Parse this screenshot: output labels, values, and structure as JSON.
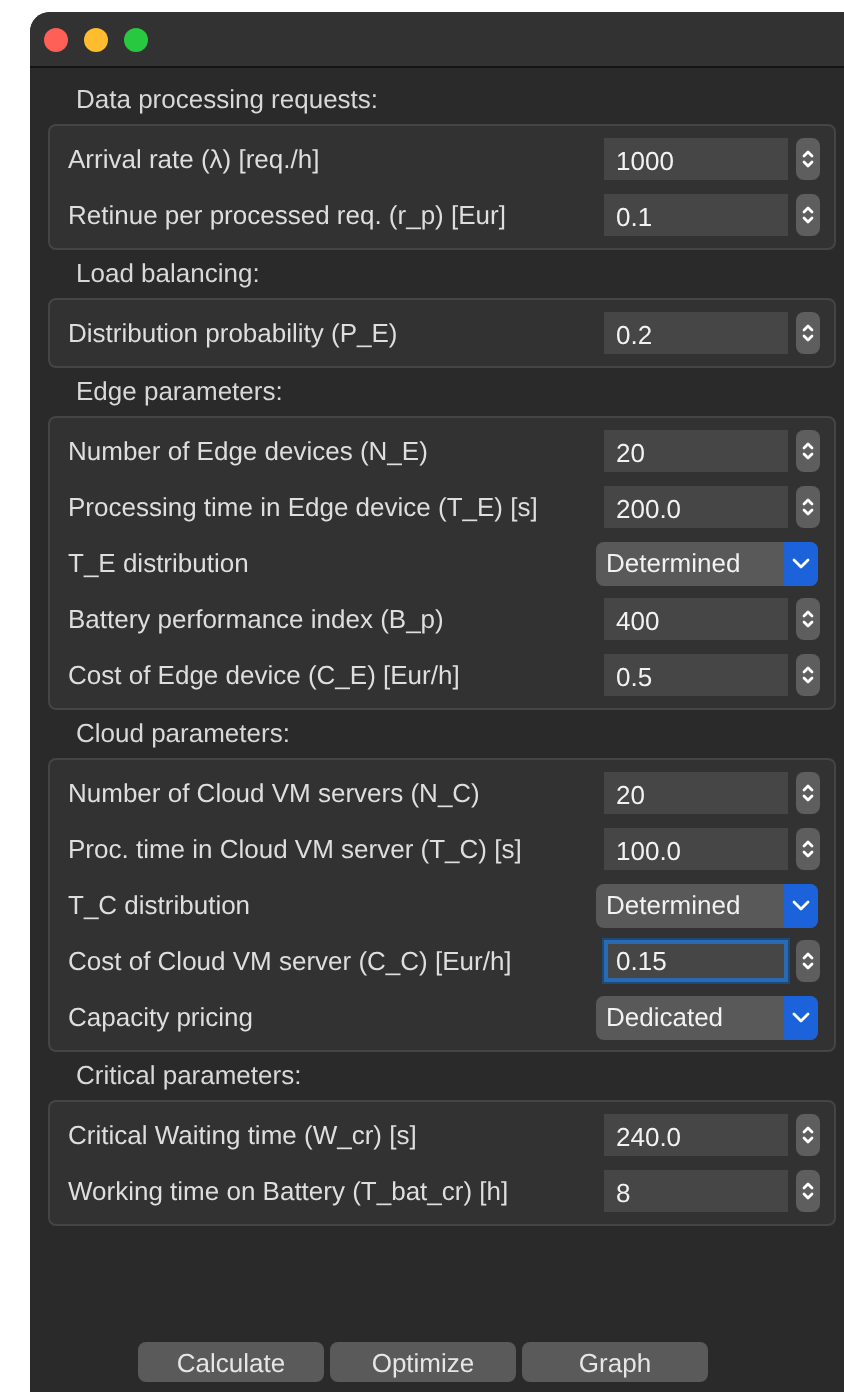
{
  "sections": [
    {
      "title": "Data processing requests:",
      "rows": [
        {
          "kind": "spin",
          "label": "Arrival rate (λ) [req./h]",
          "value": "1000",
          "focused": false
        },
        {
          "kind": "spin",
          "label": "Retinue per processed req. (r_p) [Eur]",
          "value": "0.1",
          "focused": false
        }
      ]
    },
    {
      "title": "Load balancing:",
      "rows": [
        {
          "kind": "spin",
          "label": "Distribution probability (P_E)",
          "value": "0.2",
          "focused": false
        }
      ]
    },
    {
      "title": "Edge parameters:",
      "rows": [
        {
          "kind": "spin",
          "label": "Number of Edge devices (N_E)",
          "value": "20",
          "focused": false
        },
        {
          "kind": "spin",
          "label": "Processing time in Edge device (T_E) [s]",
          "value": "200.0",
          "focused": false
        },
        {
          "kind": "combo",
          "label": "T_E distribution",
          "value": "Determined"
        },
        {
          "kind": "spin",
          "label": "Battery performance index (B_p)",
          "value": "400",
          "focused": false
        },
        {
          "kind": "spin",
          "label": "Cost of Edge device (C_E) [Eur/h]",
          "value": "0.5",
          "focused": false
        }
      ]
    },
    {
      "title": "Cloud parameters:",
      "rows": [
        {
          "kind": "spin",
          "label": "Number of Cloud VM servers (N_C)",
          "value": "20",
          "focused": false
        },
        {
          "kind": "spin",
          "label": "Proc. time in Cloud VM server (T_C) [s]",
          "value": "100.0",
          "focused": false
        },
        {
          "kind": "combo",
          "label": "T_C distribution",
          "value": "Determined"
        },
        {
          "kind": "spin",
          "label": "Cost of Cloud VM server (C_C) [Eur/h]",
          "value": "0.15",
          "focused": true
        },
        {
          "kind": "combo",
          "label": "Capacity pricing",
          "value": "Dedicated"
        }
      ]
    },
    {
      "title": "Critical parameters:",
      "rows": [
        {
          "kind": "spin",
          "label": "Critical Waiting time (W_cr) [s]",
          "value": "240.0",
          "focused": false
        },
        {
          "kind": "spin",
          "label": "Working time on Battery (T_bat_cr) [h]",
          "value": "8",
          "focused": false
        }
      ]
    }
  ],
  "buttons": [
    "Calculate",
    "Optimize",
    "Graph"
  ]
}
